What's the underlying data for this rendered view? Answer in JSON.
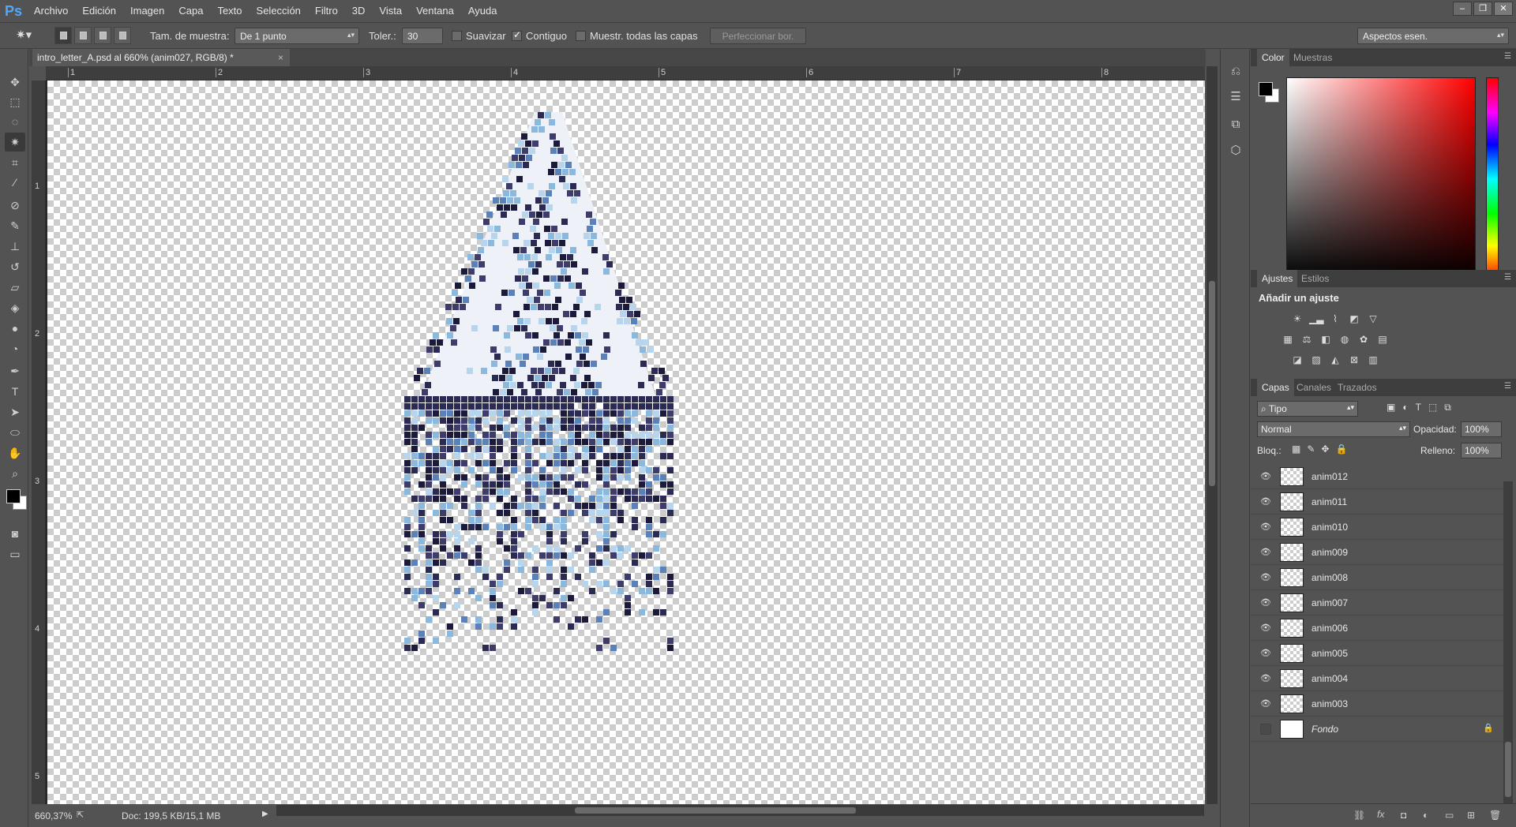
{
  "app": {
    "logo": "Ps"
  },
  "menu": [
    "Archivo",
    "Edición",
    "Imagen",
    "Capa",
    "Texto",
    "Selección",
    "Filtro",
    "3D",
    "Vista",
    "Ventana",
    "Ayuda"
  ],
  "window_controls": {
    "minimize": "–",
    "restore": "❐",
    "close": "✕"
  },
  "options": {
    "sample_size_label": "Tam. de muestra:",
    "sample_size_value": "De 1 punto",
    "tolerance_label": "Toler.:",
    "tolerance_value": "30",
    "antialias_label": "Suavizar",
    "antialias_checked": false,
    "contiguous_label": "Contiguo",
    "contiguous_checked": true,
    "sample_all_label": "Muestr. todas las capas",
    "sample_all_checked": false,
    "refine_edge_label": "Perfeccionar bor.",
    "workspace_value": "Aspectos esen."
  },
  "document": {
    "tab_title": "intro_letter_A.psd al 660% (anim027, RGB/8) *",
    "close": "×"
  },
  "rulers": {
    "horizontal": [
      "1",
      "2",
      "3",
      "4",
      "5",
      "6",
      "7",
      "8"
    ],
    "vertical": [
      "1",
      "2",
      "3",
      "4",
      "5"
    ]
  },
  "status": {
    "zoom": "660,37%",
    "doc_info": "Doc: 199,5 KB/15,1 MB"
  },
  "color_panel": {
    "tabs": [
      "Color",
      "Muestras"
    ],
    "active_tab": "Color",
    "foreground": "#000000",
    "background": "#ffffff"
  },
  "adjustments_panel": {
    "tabs": [
      "Ajustes",
      "Estilos"
    ],
    "active_tab": "Ajustes",
    "heading": "Añadir un ajuste"
  },
  "layers_panel": {
    "tabs": [
      "Capas",
      "Canales",
      "Trazados"
    ],
    "active_tab": "Capas",
    "filter_value": "Tipo",
    "blend_mode": "Normal",
    "opacity_label": "Opacidad:",
    "opacity_value": "100%",
    "lock_label": "Bloq.:",
    "fill_label": "Relleno:",
    "fill_value": "100%",
    "layers": [
      {
        "name": "anim012",
        "visible": true
      },
      {
        "name": "anim011",
        "visible": true
      },
      {
        "name": "anim010",
        "visible": true
      },
      {
        "name": "anim009",
        "visible": true
      },
      {
        "name": "anim008",
        "visible": true
      },
      {
        "name": "anim007",
        "visible": true
      },
      {
        "name": "anim006",
        "visible": true
      },
      {
        "name": "anim005",
        "visible": true
      },
      {
        "name": "anim004",
        "visible": true
      },
      {
        "name": "anim003",
        "visible": true
      },
      {
        "name": "Fondo",
        "visible": false,
        "locked": true
      }
    ]
  },
  "artwork": {
    "palette": [
      "#1c1a3a",
      "#2b2a52",
      "#3d3c6b",
      "#5a82b8",
      "#8ab9dd",
      "#b7d6ee",
      "#eef1f7"
    ]
  }
}
